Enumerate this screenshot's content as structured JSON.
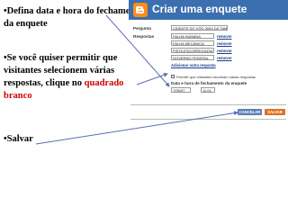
{
  "instructions": {
    "step1": "•Defina data e hora do fechamento da enquete",
    "step2_prefix": "•Se você quiser permitir que visitantes selecionem várias respostas, clique no ",
    "step2_highlight": "quadrado branco",
    "step3": "•Salvar",
    "highlight_color": "#cc0000"
  },
  "panel": {
    "title": "Criar uma enquete",
    "logo_icon": "blogger-logo-icon",
    "question_label": "Pergunta",
    "question_value": "CIDENTE DO VÔO 3054  DA TAM?",
    "answers_label": "Respostas",
    "answers": [
      {
        "value": "FALHA HUMANA",
        "remove_label": "remover"
      },
      {
        "value": "FALHA MECÂNICA",
        "remove_label": "remover"
      },
      {
        "value": "PISTA ESCORREGADIA",
        "remove_label": "remover"
      },
      {
        "value": "GOVERNO FEDERAL",
        "remove_label": "remover"
      }
    ],
    "add_answer_label": "Adicionar outra resposta",
    "multi_select_label": "Permitir que visitantes escolham várias respostas",
    "closing_label": "Data e hora de fechamento da enquete",
    "closing_date": "7/05/07",
    "closing_time": "11:04",
    "cancel_label": "CANCELAR",
    "save_label": "SALVAR"
  },
  "colors": {
    "title_bar": "#3b6fb0",
    "cancel_button": "#5a7fb5",
    "save_button": "#e07020",
    "arrow": "#5a6fb0"
  }
}
